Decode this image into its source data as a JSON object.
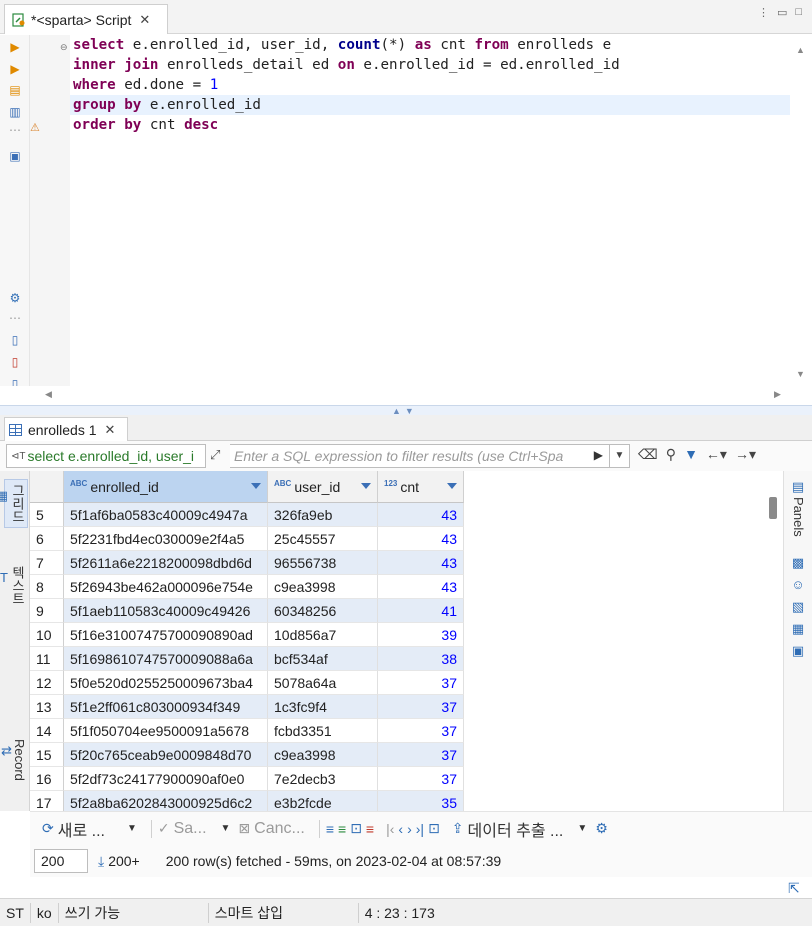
{
  "editor": {
    "tab_title": "*<sparta> Script",
    "tab_close": "✕",
    "code_lines": [
      [
        {
          "t": "select",
          "c": "kw"
        },
        {
          "t": " e.enrolled_id, user_id, ",
          "c": ""
        },
        {
          "t": "count",
          "c": "fn"
        },
        {
          "t": "(*) ",
          "c": ""
        },
        {
          "t": "as",
          "c": "kw"
        },
        {
          "t": " cnt ",
          "c": ""
        },
        {
          "t": "from",
          "c": "kw"
        },
        {
          "t": " enrolleds e",
          "c": ""
        }
      ],
      [
        {
          "t": "inner join",
          "c": "kw"
        },
        {
          "t": " enrolleds_detail ed ",
          "c": ""
        },
        {
          "t": "on",
          "c": "kw"
        },
        {
          "t": " e.enrolled_id = ed.enrolled_id",
          "c": ""
        }
      ],
      [
        {
          "t": "where",
          "c": "kw"
        },
        {
          "t": " ed.done = ",
          "c": ""
        },
        {
          "t": "1",
          "c": "num"
        }
      ],
      [
        {
          "t": "group by",
          "c": "kw"
        },
        {
          "t": " e.enrolled_id",
          "c": ""
        }
      ],
      [
        {
          "t": "order by",
          "c": "kw"
        },
        {
          "t": " cnt ",
          "c": ""
        },
        {
          "t": "desc",
          "c": "kw"
        }
      ]
    ],
    "current_line": 3
  },
  "results": {
    "tab_title": "enrolleds 1",
    "tab_close": "✕",
    "filter_query": "select e.enrolled_id, user_i",
    "filter_placeholder": "Enter a SQL expression to filter results (use Ctrl+Spa",
    "left_tabs": {
      "grid": "그리드",
      "text": "텍스트",
      "record": "Record"
    },
    "panels_label": "Panels",
    "columns": [
      {
        "name": "enrolled_id",
        "type": "ABC"
      },
      {
        "name": "user_id",
        "type": "ABC"
      },
      {
        "name": "cnt",
        "type": "123"
      }
    ],
    "rows": [
      {
        "n": "5",
        "eid": "5f1af6ba0583c40009c4947a",
        "uid": "326fa9eb",
        "cnt": "43"
      },
      {
        "n": "6",
        "eid": "5f2231fbd4ec030009e2f4a5",
        "uid": "25c45557",
        "cnt": "43"
      },
      {
        "n": "7",
        "eid": "5f2611a6e2218200098dbd6d",
        "uid": "96556738",
        "cnt": "43"
      },
      {
        "n": "8",
        "eid": "5f26943be462a000096e754e",
        "uid": "c9ea3998",
        "cnt": "43"
      },
      {
        "n": "9",
        "eid": "5f1aeb110583c40009c49426",
        "uid": "60348256",
        "cnt": "41"
      },
      {
        "n": "10",
        "eid": "5f16e3100747570009089 0ad",
        "uid": "10d856a7",
        "cnt": "39"
      },
      {
        "n": "11",
        "eid": "5f169861074757000908 8a6a",
        "uid": "bcf534af",
        "cnt": "38"
      },
      {
        "n": "12",
        "eid": "5f0e520d0255250009673ba4",
        "uid": "5078a64a",
        "cnt": "37"
      },
      {
        "n": "13",
        "eid": "5f1e2ff061c803000934f349",
        "uid": "1c3fc9f4",
        "cnt": "37"
      },
      {
        "n": "14",
        "eid": "5f1f050704ee9500091a5678",
        "uid": "fcbd3351",
        "cnt": "37"
      },
      {
        "n": "15",
        "eid": "5f20c765ceab9e0009848d70",
        "uid": "c9ea3998",
        "cnt": "37"
      },
      {
        "n": "16",
        "eid": "5f2df73c24177900090af0e0",
        "uid": "7e2decb3",
        "cnt": "37"
      },
      {
        "n": "17",
        "eid": "5f2a8ba6202843000925d6c2",
        "uid": "e3b2fcde",
        "cnt": "35"
      }
    ],
    "toolbar": {
      "new_row": "새로 ...",
      "save": "Sa...",
      "cancel": "Canc...",
      "export": "데이터 추출 ..."
    },
    "fetch": {
      "size": "200",
      "fetch_all": "200+",
      "status": "200 row(s) fetched - 59ms, on 2023-02-04 at 08:57:39"
    }
  },
  "statusbar": {
    "tz": "ST",
    "locale": "ko",
    "mode": "쓰기 가능",
    "insert": "스마트 삽입",
    "position": "4 : 23 : 173"
  }
}
